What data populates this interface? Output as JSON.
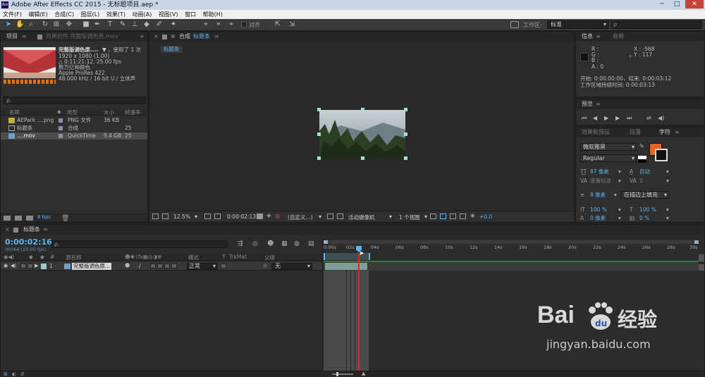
{
  "window": {
    "title": "Adobe After Effects CC 2015 - 无标题项目.aep *",
    "icon": "Ae",
    "min": "─",
    "max": "□",
    "close": "✕"
  },
  "menu": [
    "文件(F)",
    "编辑(E)",
    "合成(C)",
    "图层(L)",
    "效果(T)",
    "动画(A)",
    "视图(V)",
    "窗口",
    "帮助(H)"
  ],
  "toolbar": {
    "align_label": "对齐",
    "workspace_label": "工作区:",
    "workspace_value": "标准",
    "search_placeholder": "ρ"
  },
  "project": {
    "tab_label": "项目",
    "effects_tab": "效果控件 完整版调色原.mov",
    "clip_name": "完整版调色原....",
    "used_text": "，使用了 1 次",
    "info_lines": [
      "1920 x 1080 (1.00)",
      "△ 0:11:21:12, 25.00 fps",
      "数万亿种颜色",
      "Apple ProRes 422",
      "48.000 kHz / 16 bit U / 立体声"
    ],
    "search_placeholder": "ρ.",
    "columns": {
      "name": "名称",
      "type": "类型",
      "size": "大小",
      "rate": "帧速率"
    },
    "items": [
      {
        "name": "AEPark ....png",
        "type": "PNG 文件",
        "size": "36 KB",
        "rate": ""
      },
      {
        "name": "标题条",
        "type": "合成",
        "size": "",
        "rate": "25"
      },
      {
        "name": "....mov",
        "type": "QuickTime",
        "size": "9.4 GB",
        "rate": "25"
      }
    ],
    "bpc": "8 bpc"
  },
  "composition": {
    "tab_prefix": "合成",
    "tab_name": "标题条",
    "crumb": "标题条",
    "zoom": "12.5%",
    "timecode": "0:00:02:13",
    "resolution": "(自定义...)",
    "camera": "活动摄像机",
    "views": "1 个视图",
    "exposure": "+0.0"
  },
  "info_panel": {
    "tab_label": "信息",
    "audio_tab": "音频",
    "r": "R :",
    "g": "G :",
    "b": "B :",
    "a": "A : 0",
    "x": "X : -568",
    "y": "Y : 117",
    "start_end": "开始: 0:00:00:00，结束: 0:00:03:12",
    "work_area": "工作区域持续时间: 0:00:03:13"
  },
  "preview": {
    "tab_label": "预览"
  },
  "character": {
    "tabs": [
      "效果和预设",
      "段落",
      "字符"
    ],
    "font": "微软雅黑",
    "style": "Regular",
    "size": "87 像素",
    "leading": "自动",
    "kerning": "度量标准",
    "tracking": "0",
    "stroke": "8 像素",
    "stroke_mode": "在描边上填充",
    "vscale": "100 %",
    "hscale": "100 %",
    "baseline": "0 像素",
    "tsume": "0 %",
    "fill_color": "#e8641e"
  },
  "timeline": {
    "tab_label": "标题条",
    "timecode": "0:00:02:16",
    "fps_line": "00066 (25.00 fps)",
    "search_placeholder": "ρ.",
    "cols": {
      "num": "#",
      "source": "源名称",
      "mode": "模式",
      "t": "T",
      "trkmat": "TrkMat",
      "parent": "父级"
    },
    "layer": {
      "index": "1",
      "name": "完整版调色原...",
      "mode": "正常",
      "parent": "无"
    },
    "ticks": [
      "0:00s",
      "02s",
      "04s",
      "06s",
      "08s",
      "10s",
      "12s",
      "14s",
      "16s",
      "18s",
      "20s",
      "22s",
      "24s",
      "26s",
      "28s",
      "30s"
    ]
  },
  "watermark": {
    "brand": "Bai",
    "brand2": "经验",
    "url": "jingyan.baidu.com"
  }
}
